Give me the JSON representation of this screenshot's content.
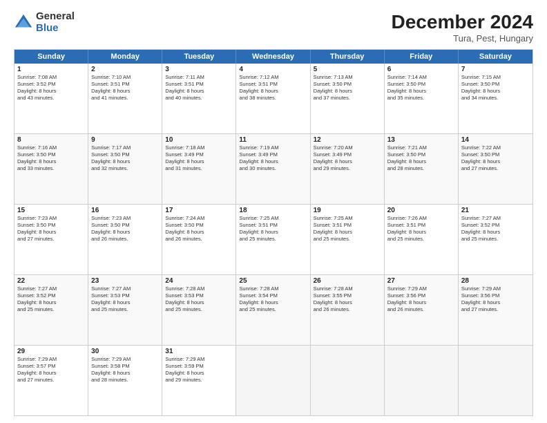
{
  "logo": {
    "general": "General",
    "blue": "Blue"
  },
  "title": "December 2024",
  "location": "Tura, Pest, Hungary",
  "days_of_week": [
    "Sunday",
    "Monday",
    "Tuesday",
    "Wednesday",
    "Thursday",
    "Friday",
    "Saturday"
  ],
  "weeks": [
    [
      {
        "day": "1",
        "lines": [
          "Sunrise: 7:08 AM",
          "Sunset: 3:52 PM",
          "Daylight: 8 hours",
          "and 43 minutes."
        ]
      },
      {
        "day": "2",
        "lines": [
          "Sunrise: 7:10 AM",
          "Sunset: 3:51 PM",
          "Daylight: 8 hours",
          "and 41 minutes."
        ]
      },
      {
        "day": "3",
        "lines": [
          "Sunrise: 7:11 AM",
          "Sunset: 3:51 PM",
          "Daylight: 8 hours",
          "and 40 minutes."
        ]
      },
      {
        "day": "4",
        "lines": [
          "Sunrise: 7:12 AM",
          "Sunset: 3:51 PM",
          "Daylight: 8 hours",
          "and 38 minutes."
        ]
      },
      {
        "day": "5",
        "lines": [
          "Sunrise: 7:13 AM",
          "Sunset: 3:50 PM",
          "Daylight: 8 hours",
          "and 37 minutes."
        ]
      },
      {
        "day": "6",
        "lines": [
          "Sunrise: 7:14 AM",
          "Sunset: 3:50 PM",
          "Daylight: 8 hours",
          "and 35 minutes."
        ]
      },
      {
        "day": "7",
        "lines": [
          "Sunrise: 7:15 AM",
          "Sunset: 3:50 PM",
          "Daylight: 8 hours",
          "and 34 minutes."
        ]
      }
    ],
    [
      {
        "day": "8",
        "lines": [
          "Sunrise: 7:16 AM",
          "Sunset: 3:50 PM",
          "Daylight: 8 hours",
          "and 33 minutes."
        ]
      },
      {
        "day": "9",
        "lines": [
          "Sunrise: 7:17 AM",
          "Sunset: 3:50 PM",
          "Daylight: 8 hours",
          "and 32 minutes."
        ]
      },
      {
        "day": "10",
        "lines": [
          "Sunrise: 7:18 AM",
          "Sunset: 3:49 PM",
          "Daylight: 8 hours",
          "and 31 minutes."
        ]
      },
      {
        "day": "11",
        "lines": [
          "Sunrise: 7:19 AM",
          "Sunset: 3:49 PM",
          "Daylight: 8 hours",
          "and 30 minutes."
        ]
      },
      {
        "day": "12",
        "lines": [
          "Sunrise: 7:20 AM",
          "Sunset: 3:49 PM",
          "Daylight: 8 hours",
          "and 29 minutes."
        ]
      },
      {
        "day": "13",
        "lines": [
          "Sunrise: 7:21 AM",
          "Sunset: 3:50 PM",
          "Daylight: 8 hours",
          "and 28 minutes."
        ]
      },
      {
        "day": "14",
        "lines": [
          "Sunrise: 7:22 AM",
          "Sunset: 3:50 PM",
          "Daylight: 8 hours",
          "and 27 minutes."
        ]
      }
    ],
    [
      {
        "day": "15",
        "lines": [
          "Sunrise: 7:23 AM",
          "Sunset: 3:50 PM",
          "Daylight: 8 hours",
          "and 27 minutes."
        ]
      },
      {
        "day": "16",
        "lines": [
          "Sunrise: 7:23 AM",
          "Sunset: 3:50 PM",
          "Daylight: 8 hours",
          "and 26 minutes."
        ]
      },
      {
        "day": "17",
        "lines": [
          "Sunrise: 7:24 AM",
          "Sunset: 3:50 PM",
          "Daylight: 8 hours",
          "and 26 minutes."
        ]
      },
      {
        "day": "18",
        "lines": [
          "Sunrise: 7:25 AM",
          "Sunset: 3:51 PM",
          "Daylight: 8 hours",
          "and 25 minutes."
        ]
      },
      {
        "day": "19",
        "lines": [
          "Sunrise: 7:25 AM",
          "Sunset: 3:51 PM",
          "Daylight: 8 hours",
          "and 25 minutes."
        ]
      },
      {
        "day": "20",
        "lines": [
          "Sunrise: 7:26 AM",
          "Sunset: 3:51 PM",
          "Daylight: 8 hours",
          "and 25 minutes."
        ]
      },
      {
        "day": "21",
        "lines": [
          "Sunrise: 7:27 AM",
          "Sunset: 3:52 PM",
          "Daylight: 8 hours",
          "and 25 minutes."
        ]
      }
    ],
    [
      {
        "day": "22",
        "lines": [
          "Sunrise: 7:27 AM",
          "Sunset: 3:52 PM",
          "Daylight: 8 hours",
          "and 25 minutes."
        ]
      },
      {
        "day": "23",
        "lines": [
          "Sunrise: 7:27 AM",
          "Sunset: 3:53 PM",
          "Daylight: 8 hours",
          "and 25 minutes."
        ]
      },
      {
        "day": "24",
        "lines": [
          "Sunrise: 7:28 AM",
          "Sunset: 3:53 PM",
          "Daylight: 8 hours",
          "and 25 minutes."
        ]
      },
      {
        "day": "25",
        "lines": [
          "Sunrise: 7:28 AM",
          "Sunset: 3:54 PM",
          "Daylight: 8 hours",
          "and 25 minutes."
        ]
      },
      {
        "day": "26",
        "lines": [
          "Sunrise: 7:28 AM",
          "Sunset: 3:55 PM",
          "Daylight: 8 hours",
          "and 26 minutes."
        ]
      },
      {
        "day": "27",
        "lines": [
          "Sunrise: 7:29 AM",
          "Sunset: 3:56 PM",
          "Daylight: 8 hours",
          "and 26 minutes."
        ]
      },
      {
        "day": "28",
        "lines": [
          "Sunrise: 7:29 AM",
          "Sunset: 3:56 PM",
          "Daylight: 8 hours",
          "and 27 minutes."
        ]
      }
    ],
    [
      {
        "day": "29",
        "lines": [
          "Sunrise: 7:29 AM",
          "Sunset: 3:57 PM",
          "Daylight: 8 hours",
          "and 27 minutes."
        ]
      },
      {
        "day": "30",
        "lines": [
          "Sunrise: 7:29 AM",
          "Sunset: 3:58 PM",
          "Daylight: 8 hours",
          "and 28 minutes."
        ]
      },
      {
        "day": "31",
        "lines": [
          "Sunrise: 7:29 AM",
          "Sunset: 3:59 PM",
          "Daylight: 8 hours",
          "and 29 minutes."
        ]
      },
      {
        "day": "",
        "lines": []
      },
      {
        "day": "",
        "lines": []
      },
      {
        "day": "",
        "lines": []
      },
      {
        "day": "",
        "lines": []
      }
    ]
  ]
}
